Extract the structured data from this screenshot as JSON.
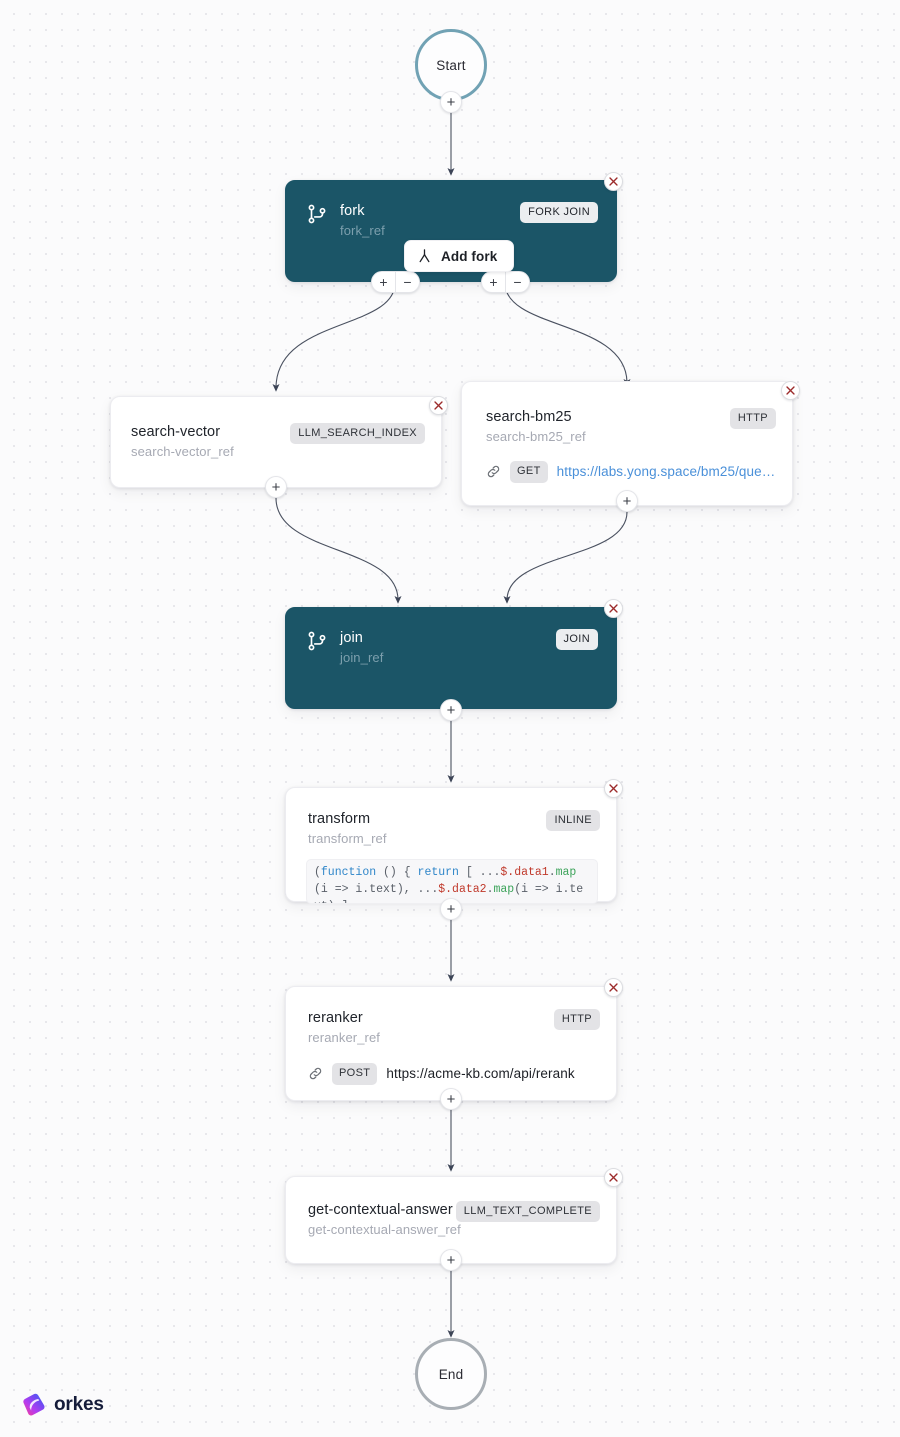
{
  "app": {
    "logo_text": "orkes",
    "logo_icon": "orkes-logo-icon"
  },
  "terminals": {
    "start": {
      "label": "Start"
    },
    "end": {
      "label": "End"
    }
  },
  "buttons": {
    "add_fork": {
      "label": "Add fork",
      "icon": "fork-branch-icon"
    },
    "plus": "+",
    "minus": "−",
    "delete_icon": "close-x-icon"
  },
  "nodes": [
    {
      "id": "fork",
      "name": "fork",
      "ref": "fork_ref",
      "type_badge": "FORK JOIN",
      "style": "dark",
      "icon": "git-branch-icon"
    },
    {
      "id": "search-vector",
      "name": "search-vector",
      "ref": "search-vector_ref",
      "type_badge": "LLM_SEARCH_INDEX",
      "style": "light"
    },
    {
      "id": "search-bm25",
      "name": "search-bm25",
      "ref": "search-bm25_ref",
      "type_badge": "HTTP",
      "style": "light",
      "http": {
        "method": "GET",
        "url": "https://labs.yong.space/bm25/que…",
        "icon": "link-chain-icon",
        "link_colored": true
      }
    },
    {
      "id": "join",
      "name": "join",
      "ref": "join_ref",
      "type_badge": "JOIN",
      "style": "dark",
      "icon": "git-branch-icon"
    },
    {
      "id": "transform",
      "name": "transform",
      "ref": "transform_ref",
      "type_badge": "INLINE",
      "style": "light",
      "code_tokens": [
        {
          "t": "(",
          "c": "pn"
        },
        {
          "t": "function",
          "c": "kw"
        },
        {
          "t": " () { ",
          "c": "pn"
        },
        {
          "t": "return",
          "c": "kw"
        },
        {
          "t": " [ ...",
          "c": "pn"
        },
        {
          "t": "$",
          "c": "pr"
        },
        {
          "t": ".data1",
          "c": "pr"
        },
        {
          "t": ".",
          "c": "pn"
        },
        {
          "t": "map",
          "c": "fn"
        },
        {
          "t": "(i => i.text), ...",
          "c": "pn"
        },
        {
          "t": "$",
          "c": "pr"
        },
        {
          "t": ".data2",
          "c": "pr"
        },
        {
          "t": ".",
          "c": "pn"
        },
        {
          "t": "map",
          "c": "fn"
        },
        {
          "t": "(i => i.text) ]\n})();",
          "c": "pn"
        }
      ]
    },
    {
      "id": "reranker",
      "name": "reranker",
      "ref": "reranker_ref",
      "type_badge": "HTTP",
      "style": "light",
      "http": {
        "method": "POST",
        "url": "https://acme-kb.com/api/rerank",
        "icon": "link-chain-icon",
        "link_colored": false
      }
    },
    {
      "id": "get-contextual-answer",
      "name": "get-contextual-answer",
      "ref": "get-contextual-answer_ref",
      "type_badge": "LLM_TEXT_COMPLETE",
      "style": "light"
    }
  ],
  "colors": {
    "dark_node": "#1b5567",
    "start_ring": "#71a2b4",
    "end_ring": "#a8aeb4",
    "badge_bg": "#e3e3e6",
    "link_blue": "#4a90d9",
    "delete_x": "#9c2b2b",
    "edge_stroke": "#4a5160",
    "canvas_bg": "#fbfbfc"
  }
}
